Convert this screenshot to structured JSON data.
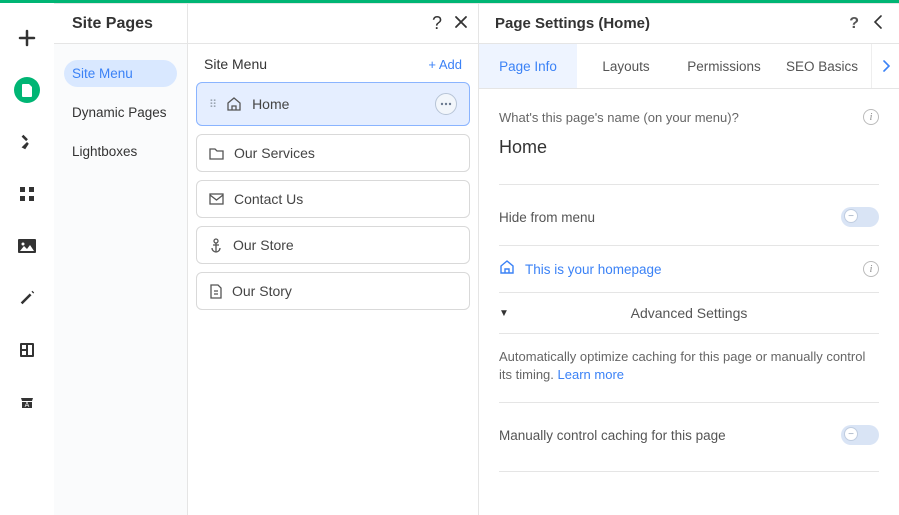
{
  "sitePages": {
    "title": "Site Pages",
    "nav": {
      "siteMenu": "Site Menu",
      "dynamicPages": "Dynamic Pages",
      "lightboxes": "Lightboxes"
    }
  },
  "siteMenu": {
    "heading": "Site Menu",
    "addLabel": "+ Add",
    "pages": [
      {
        "name": "Home"
      },
      {
        "name": "Our Services"
      },
      {
        "name": "Contact Us"
      },
      {
        "name": "Our Store"
      },
      {
        "name": "Our Story"
      }
    ]
  },
  "pageSettings": {
    "title": "Page Settings (Home)",
    "tabs": {
      "pageInfo": "Page Info",
      "layouts": "Layouts",
      "permissions": "Permissions",
      "seoBasics": "SEO Basics"
    },
    "nameQuestion": "What's this page's name (on your menu)?",
    "pageName": "Home",
    "hideFromMenu": "Hide from menu",
    "homepageMessage": "This is your homepage",
    "advancedSettings": "Advanced Settings",
    "cachingDesc": "Automatically optimize caching for this page or manually control its timing.",
    "learnMore": "Learn more",
    "manualCaching": "Manually control caching for this page"
  }
}
